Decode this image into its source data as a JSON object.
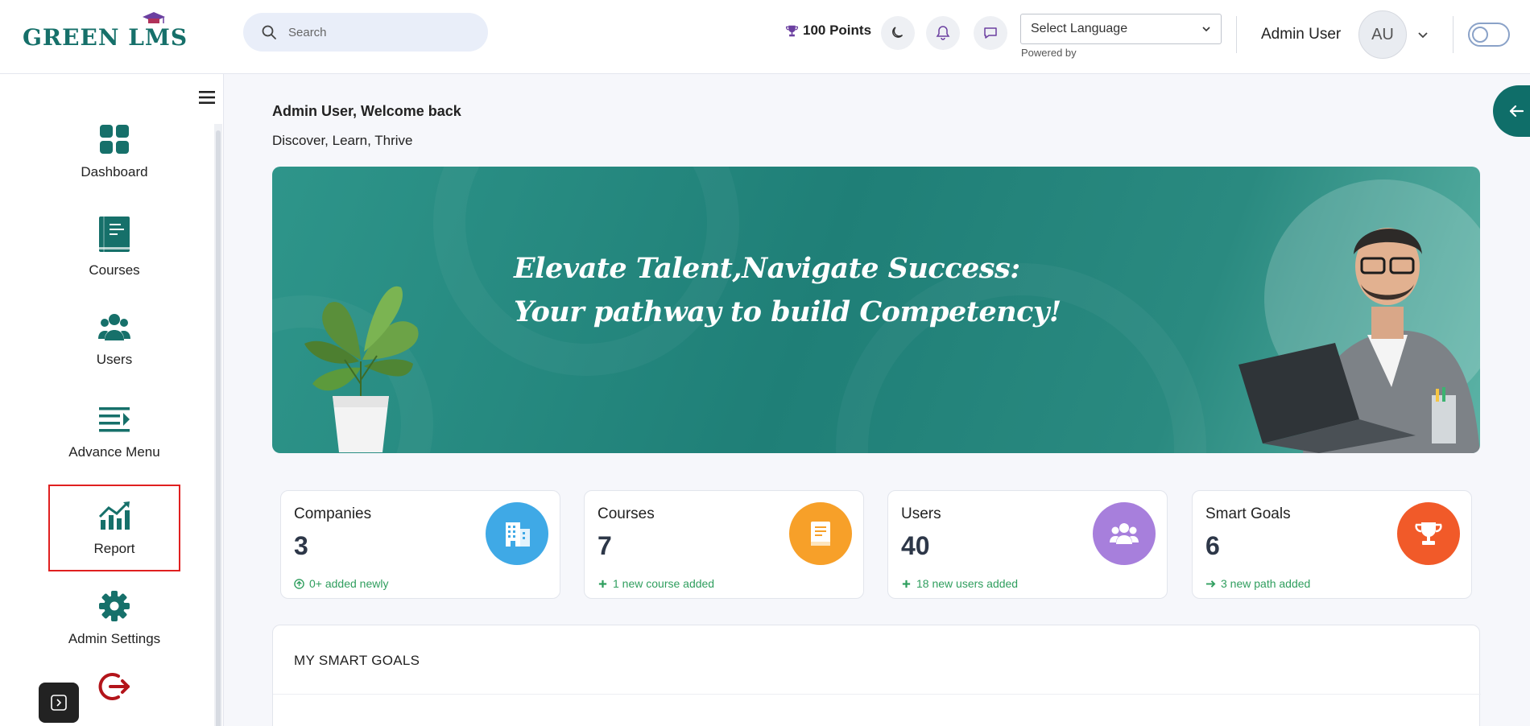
{
  "header": {
    "logo_text_1": "GREEN L",
    "logo_text_2": "MS",
    "search_placeholder": "Search",
    "points": "100 Points",
    "language_select": "Select Language",
    "powered_by": "Powered by",
    "user_name": "Admin User",
    "avatar_initials": "AU"
  },
  "sidebar": {
    "items": [
      {
        "label": "Dashboard",
        "icon": "dashboard-icon"
      },
      {
        "label": "Courses",
        "icon": "book-icon"
      },
      {
        "label": "Users",
        "icon": "users-icon"
      },
      {
        "label": "Advance Menu",
        "icon": "advance-menu-icon"
      },
      {
        "label": "Report",
        "icon": "report-chart-icon"
      },
      {
        "label": "Admin Settings",
        "icon": "gear-icon"
      },
      {
        "label": "",
        "icon": "logout-icon"
      }
    ]
  },
  "main": {
    "welcome": "Admin User, Welcome back",
    "tagline": "Discover, Learn, Thrive",
    "banner_line_1": "Elevate Talent,Navigate Success:",
    "banner_line_2": "Your pathway to build Competency!",
    "stats": [
      {
        "title": "Companies",
        "value": "3",
        "note": "0+ added newly",
        "color": "#3fa9e6"
      },
      {
        "title": "Courses",
        "value": "7",
        "note": "1 new course added",
        "color": "#f7a029"
      },
      {
        "title": "Users",
        "value": "40",
        "note": "18 new users added",
        "color": "#a77fdc"
      },
      {
        "title": "Smart Goals",
        "value": "6",
        "note": "3 new path added",
        "color": "#f15a29"
      }
    ],
    "goals_title": "MY SMART GOALS"
  },
  "colors": {
    "brand": "#16706a",
    "note_green": "#2f9e5e",
    "active_border": "#e02020"
  }
}
